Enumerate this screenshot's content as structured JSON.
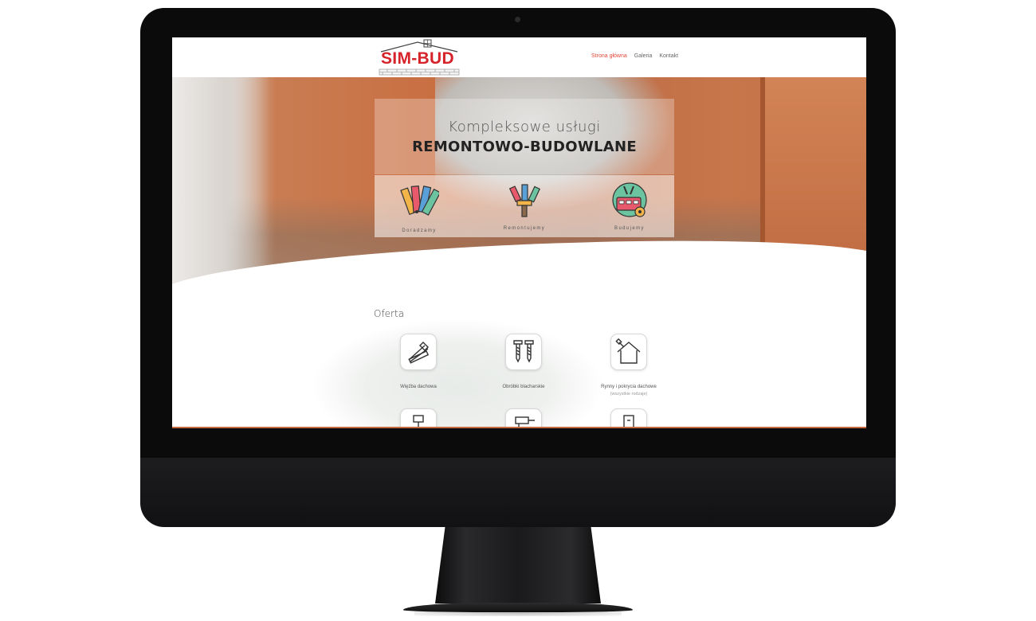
{
  "site": {
    "logo_text": "SIM-BUD",
    "nav": [
      {
        "label": "Strona główna",
        "active": true
      },
      {
        "label": "Galeria",
        "active": false
      },
      {
        "label": "Kontakt",
        "active": false
      }
    ]
  },
  "hero": {
    "title_light": "Kompleksowe usługi",
    "title_bold": "REMONTOWO-BUDOWLANE",
    "services": [
      {
        "label": "Doradzamy",
        "icon": "color-palette-icon"
      },
      {
        "label": "Remontujemy",
        "icon": "paint-brushes-icon"
      },
      {
        "label": "Budujemy",
        "icon": "construction-tools-icon"
      }
    ]
  },
  "offer": {
    "title": "Oferta",
    "items": [
      {
        "label": "Więźba dachowa",
        "sub": "",
        "icon": "roof-truss-icon"
      },
      {
        "label": "Obróbki blacharskie",
        "sub": "",
        "icon": "screws-icon"
      },
      {
        "label": "Rynny i pokrycia dachowe",
        "sub": "(wszystkie rodzaje)",
        "icon": "house-roof-icon"
      }
    ]
  },
  "colors": {
    "brand_red": "#d6232a",
    "nav_active": "#e0483a",
    "brick": "#c96e41"
  }
}
